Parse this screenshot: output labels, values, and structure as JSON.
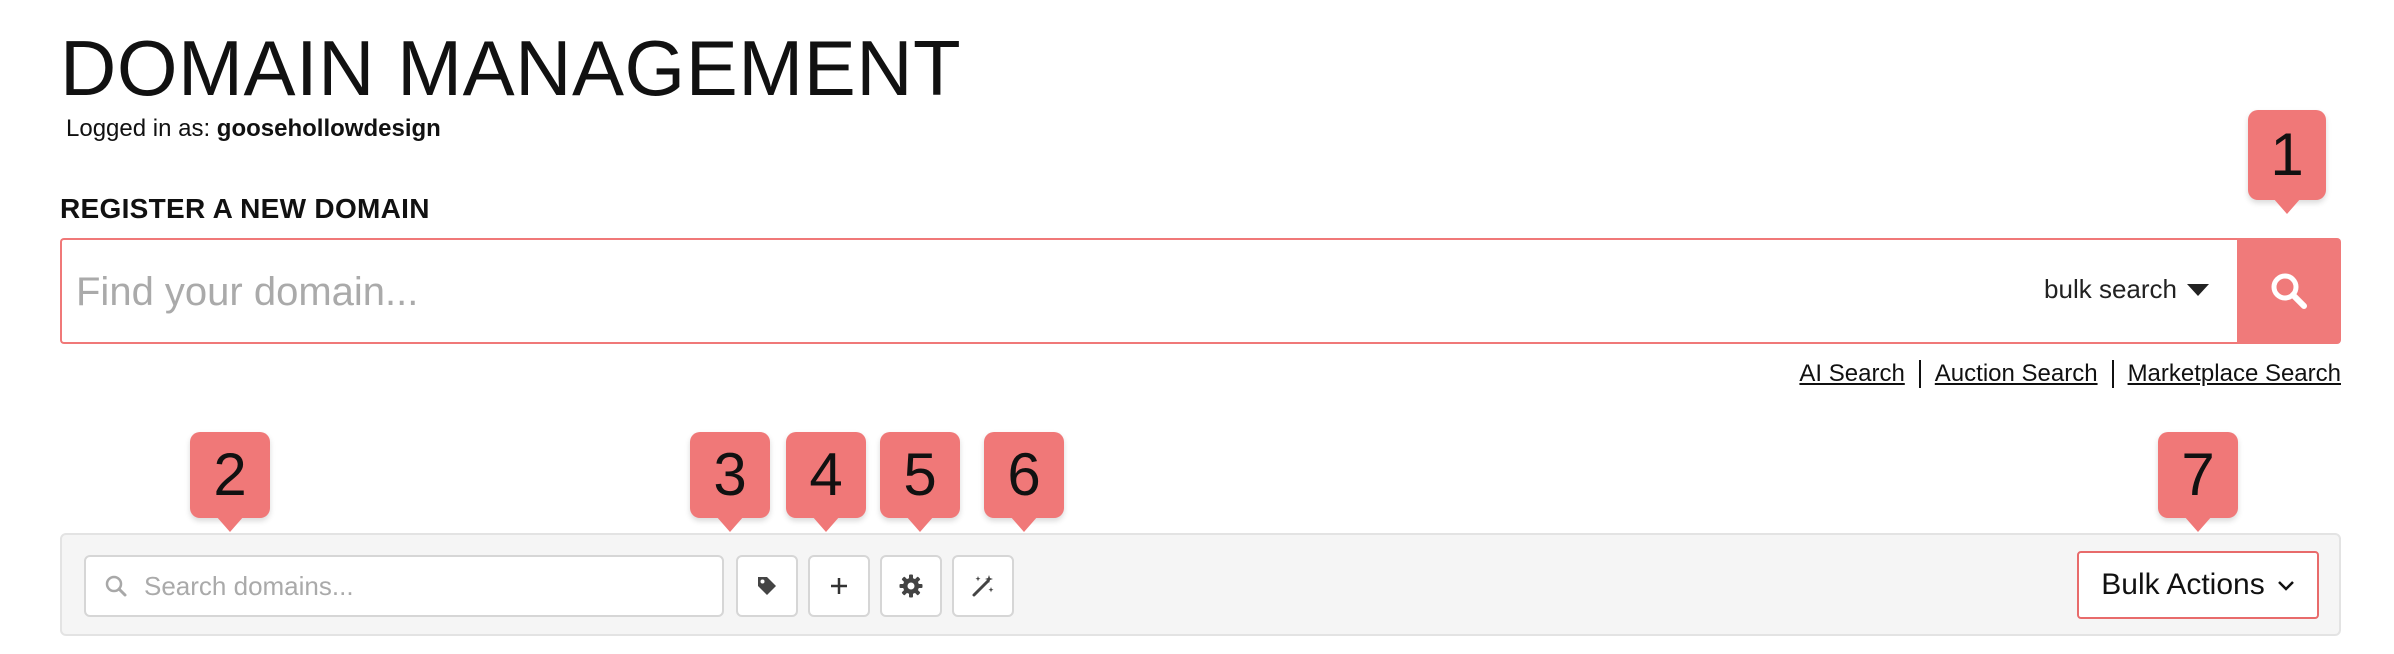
{
  "header": {
    "title": "DOMAIN MANAGEMENT",
    "logged_in_prefix": "Logged in as: ",
    "username": "goosehollowdesign"
  },
  "register": {
    "heading": "REGISTER A NEW DOMAIN",
    "placeholder": "Find your domain...",
    "value": "",
    "bulk_search_label": "bulk search",
    "search_icon": "search-icon"
  },
  "search_links": [
    {
      "label": "AI Search"
    },
    {
      "label": "Auction Search"
    },
    {
      "label": "Marketplace Search"
    }
  ],
  "toolbar": {
    "search_placeholder": "Search domains...",
    "search_value": "",
    "buttons": [
      {
        "icon": "tag-icon"
      },
      {
        "icon": "plus-icon"
      },
      {
        "icon": "gear-icon"
      },
      {
        "icon": "magic-wand-icon"
      }
    ],
    "bulk_actions_label": "Bulk Actions"
  },
  "markers": [
    "1",
    "2",
    "3",
    "4",
    "5",
    "6",
    "7"
  ],
  "colors": {
    "accent": "#f07878",
    "toolbar_bg": "#f5f5f5",
    "border": "#d6d6d6"
  }
}
